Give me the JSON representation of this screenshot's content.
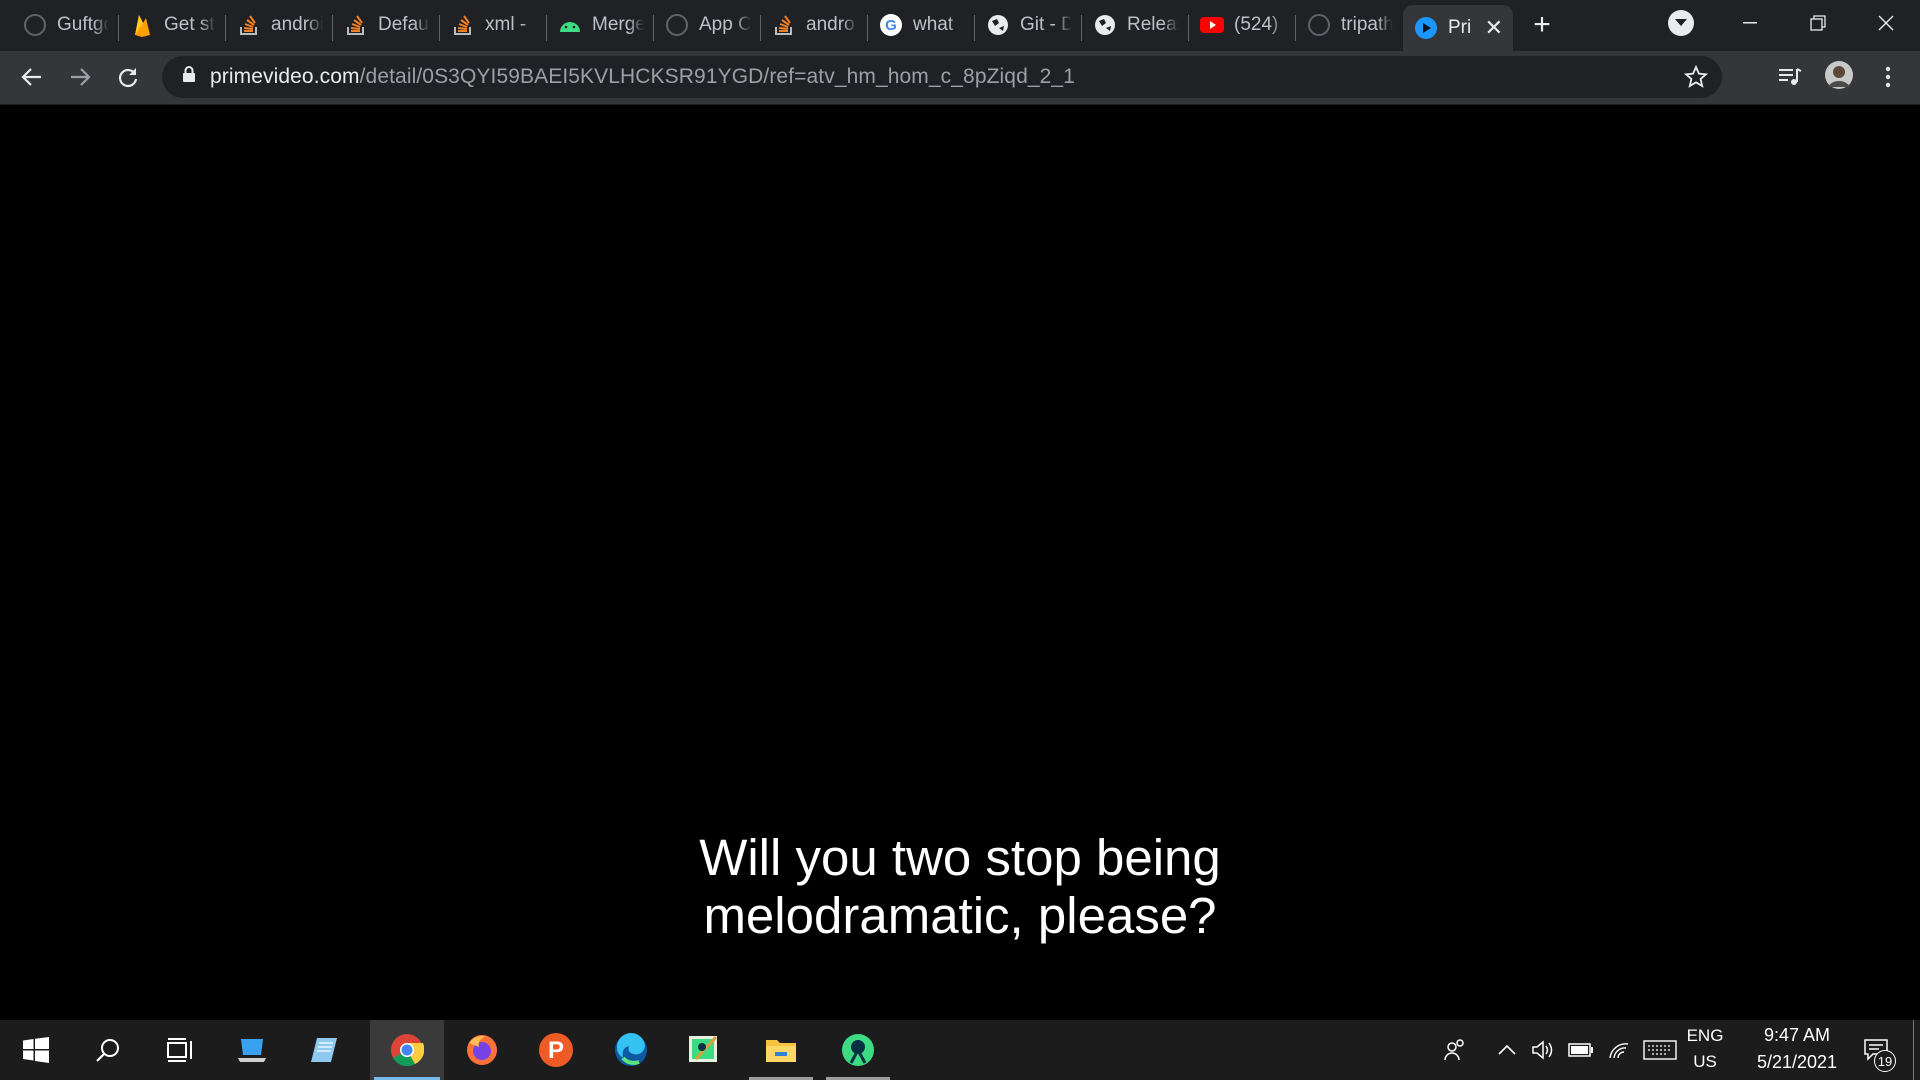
{
  "browser": {
    "tabs": [
      {
        "title": "Guftgo",
        "icon": "github-icon"
      },
      {
        "title": "Get started",
        "icon": "firebase-icon"
      },
      {
        "title": "android",
        "icon": "stackoverflow-icon"
      },
      {
        "title": "Default",
        "icon": "stackoverflow-icon"
      },
      {
        "title": "xml -",
        "icon": "stackoverflow-icon"
      },
      {
        "title": "Merge",
        "icon": "android-icon"
      },
      {
        "title": "App C",
        "icon": "github-icon"
      },
      {
        "title": "andro",
        "icon": "stackoverflow-icon"
      },
      {
        "title": "what",
        "icon": "google-icon"
      },
      {
        "title": "Git - D",
        "icon": "globe-icon"
      },
      {
        "title": "Releas",
        "icon": "globe-icon"
      },
      {
        "title": "(524)",
        "icon": "youtube-icon"
      },
      {
        "title": "tripath",
        "icon": "github-icon"
      },
      {
        "title": "Pri",
        "icon": "primevideo-icon",
        "active": true
      }
    ],
    "url_host": "primevideo.com",
    "url_path": "/detail/0S3QYI59BAEI5KVLHCKSR91YGD/ref=atv_hm_hom_c_8pZiqd_2_1"
  },
  "player": {
    "subtitle_line1": "Will you two stop being",
    "subtitle_line2": "melodramatic, please?"
  },
  "taskbar": {
    "apps": [
      "start",
      "search",
      "task-view",
      "this-pc",
      "notepad",
      "chrome",
      "firefox",
      "postman",
      "edge",
      "android-studio",
      "file-explorer",
      "android-app"
    ],
    "lang_top": "ENG",
    "lang_bottom": "US",
    "time": "9:47 AM",
    "date": "5/21/2021",
    "notification_count": "19"
  },
  "colors": {
    "tabstrip": "#202124",
    "toolbar": "#35363a",
    "taskbar": "#1c1c1c",
    "accent": "#76b9ed"
  }
}
